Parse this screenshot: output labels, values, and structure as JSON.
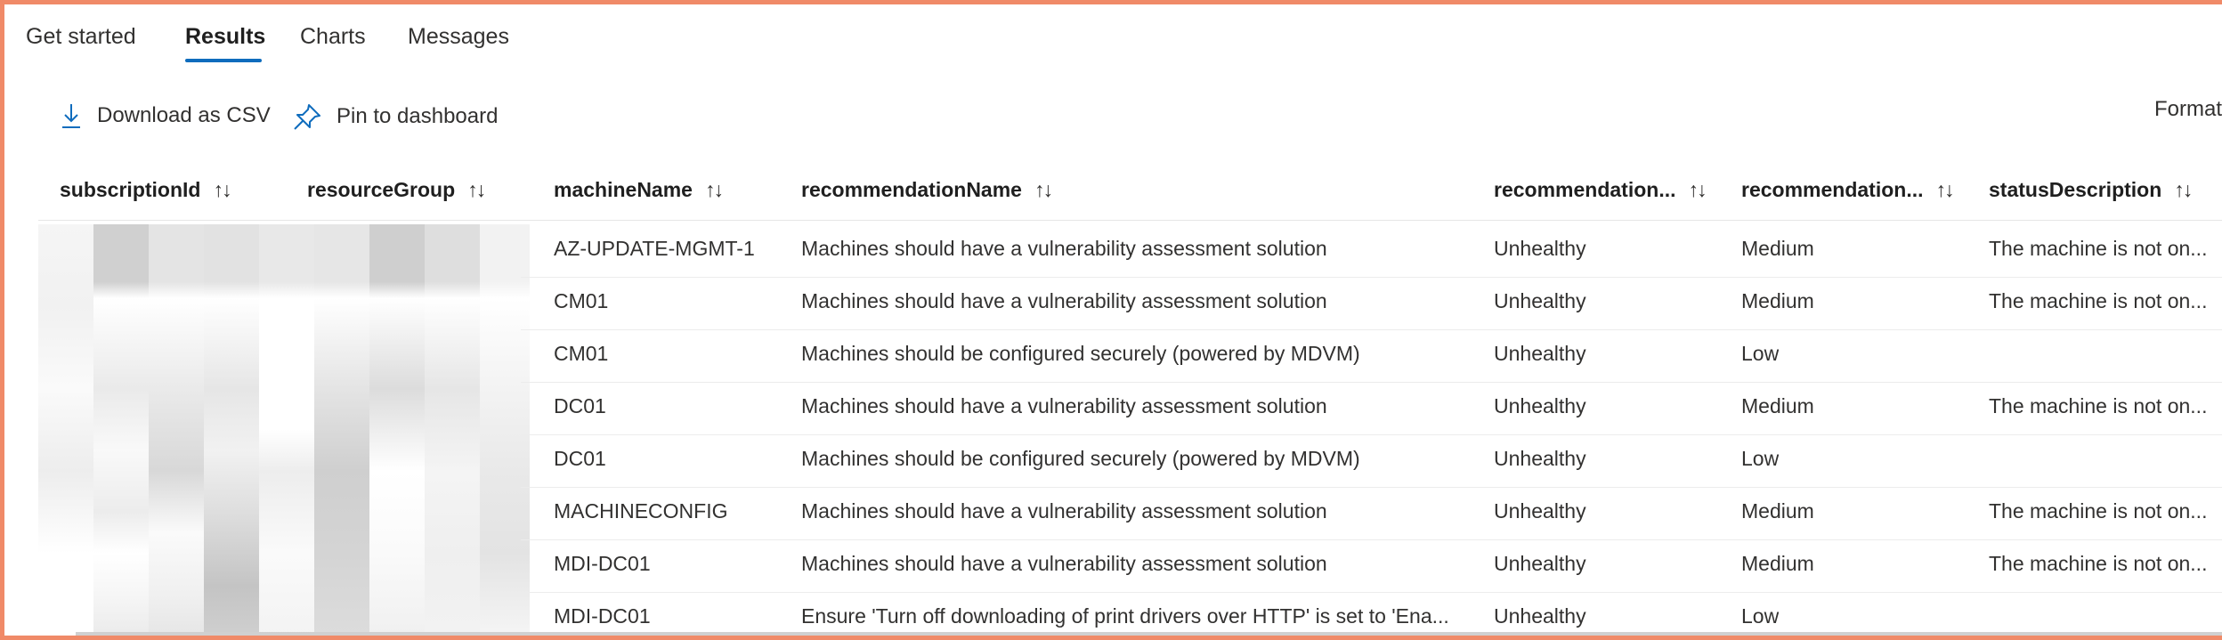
{
  "tabs": [
    {
      "label": "Get started",
      "active": false
    },
    {
      "label": "Results",
      "active": true
    },
    {
      "label": "Charts",
      "active": false
    },
    {
      "label": "Messages",
      "active": false
    }
  ],
  "toolbar": {
    "download_label": "Download as CSV",
    "pin_label": "Pin to dashboard",
    "format_label": "Format"
  },
  "table": {
    "columns": [
      "subscriptionId",
      "resourceGroup",
      "machineName",
      "recommendationName",
      "recommendation...",
      "recommendation...",
      "statusDescription"
    ],
    "sort_glyph": "↑↓",
    "rows": [
      [
        "AZ-UPDATE-MGMT-1",
        "Machines should have a vulnerability assessment solution",
        "Unhealthy",
        "Medium",
        "The machine is not on..."
      ],
      [
        "CM01",
        "Machines should have a vulnerability assessment solution",
        "Unhealthy",
        "Medium",
        "The machine is not on..."
      ],
      [
        "CM01",
        "Machines should be configured securely (powered by MDVM)",
        "Unhealthy",
        "Low",
        ""
      ],
      [
        "DC01",
        "Machines should have a vulnerability assessment solution",
        "Unhealthy",
        "Medium",
        "The machine is not on..."
      ],
      [
        "DC01",
        "Machines should be configured securely (powered by MDVM)",
        "Unhealthy",
        "Low",
        ""
      ],
      [
        "MACHINECONFIG",
        "Machines should have a vulnerability assessment solution",
        "Unhealthy",
        "Medium",
        "The machine is not on..."
      ],
      [
        "MDI-DC01",
        "Machines should have a vulnerability assessment solution",
        "Unhealthy",
        "Medium",
        "The machine is not on..."
      ],
      [
        "MDI-DC01",
        "Ensure 'Turn off downloading of print drivers over HTTP' is set to 'Ena...",
        "Unhealthy",
        "Low",
        ""
      ]
    ]
  },
  "colors": {
    "accent": "#0f6cbd",
    "frame": "#f08a68"
  }
}
